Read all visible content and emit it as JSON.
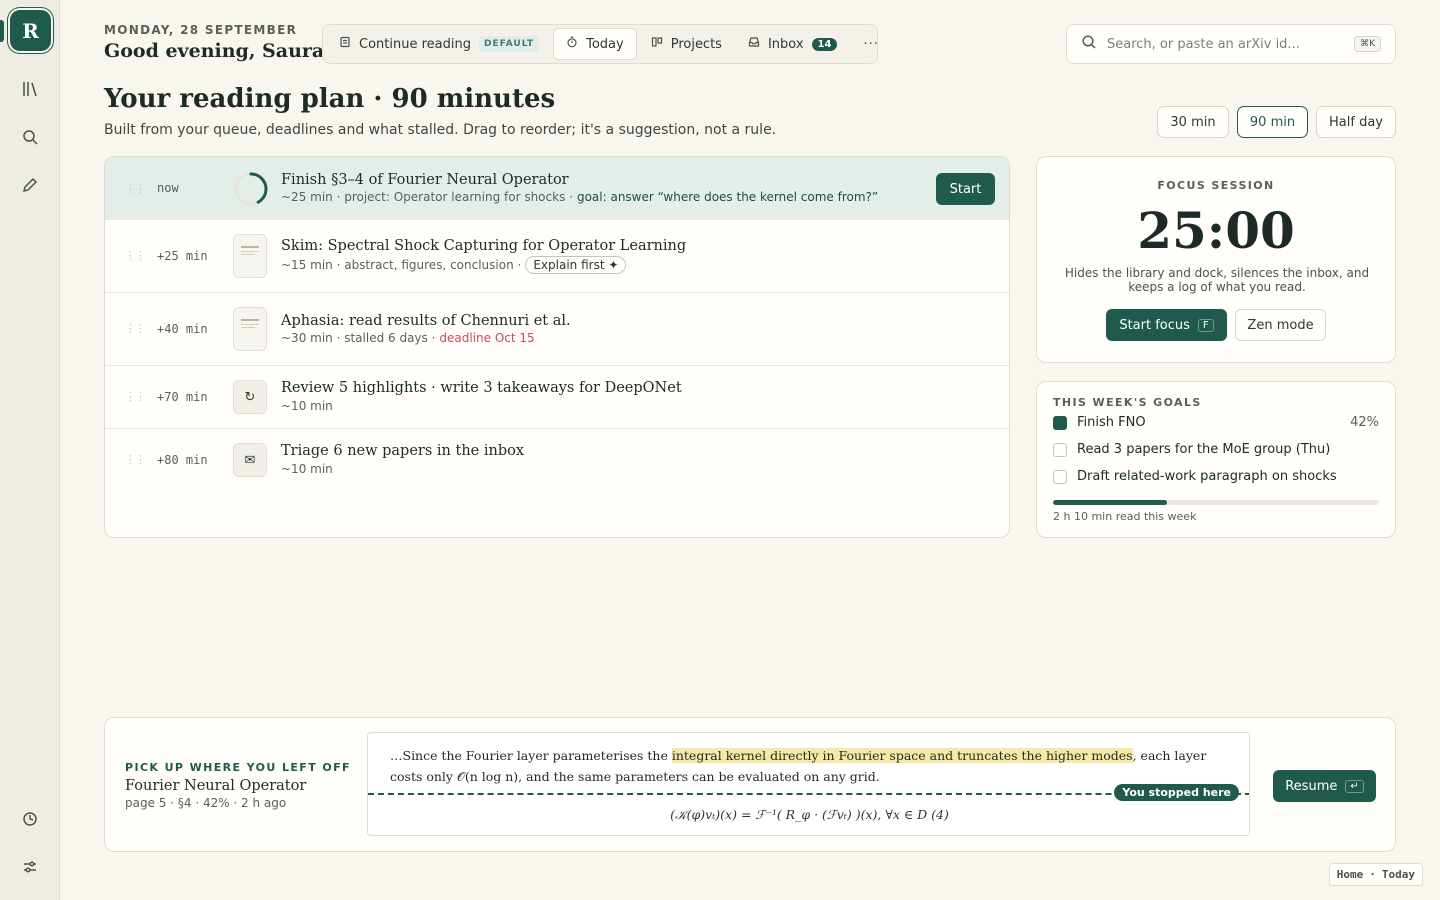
{
  "sidebar": {
    "logo": "R",
    "icons": [
      "library-icon",
      "search-icon",
      "pen-icon",
      "history-icon",
      "settings-sliders-icon"
    ]
  },
  "header": {
    "date": "MONDAY, 28 SEPTEMBER",
    "greeting": "Good evening, Saurav",
    "tabs": [
      {
        "label": "Continue reading",
        "tag": "DEFAULT",
        "icon": "document-icon"
      },
      {
        "label": "Today",
        "icon": "timer-icon",
        "active": true
      },
      {
        "label": "Projects",
        "icon": "kanban-icon"
      },
      {
        "label": "Inbox",
        "count": "14",
        "icon": "inbox-icon"
      }
    ],
    "more": "···",
    "search": {
      "placeholder": "Search, or paste an arXiv id...",
      "shortcut": "⌘K"
    }
  },
  "plan": {
    "title": "Your reading plan · 90 minutes",
    "subtitle": "Built from your queue, deadlines and what stalled. Drag to reorder; it's a suggestion, not a rule.",
    "durations": [
      {
        "label": "30 min"
      },
      {
        "label": "90 min",
        "active": true
      },
      {
        "label": "Half day"
      }
    ],
    "items": [
      {
        "offset": "now",
        "title": "Finish §3–4 of Fourier Neural Operator",
        "meta": "~25 min · project: Operator learning for shocks ·",
        "goal": "goal: answer “where does the kernel come from?”",
        "action": "Start",
        "progress": 0.42,
        "icon": "progress-ring-icon"
      },
      {
        "offset": "+25 min",
        "title": "Skim: Spectral Shock Capturing for Operator Learning",
        "meta": "~15 min · abstract, figures, conclusion ·",
        "chip": "Explain first ✦",
        "icon": "paper-thumbnail-icon"
      },
      {
        "offset": "+40 min",
        "title": "Aphasia: read results of Chennuri et al.",
        "meta": "~30 min · stalled 6 days ·",
        "deadline": "deadline Oct 15",
        "icon": "paper-thumbnail-icon"
      },
      {
        "offset": "+70 min",
        "title": "Review 5 highlights · write 3 takeaways for DeepONet",
        "meta": "~10 min",
        "glyph": "↻",
        "icon": "refresh-icon"
      },
      {
        "offset": "+80 min",
        "title": "Triage 6 new papers in the inbox",
        "meta": "~10 min",
        "glyph": "✉",
        "icon": "mail-icon"
      }
    ]
  },
  "focus": {
    "label": "FOCUS SESSION",
    "time": "25:00",
    "description": "Hides the library and dock, silences the inbox, and keeps a log of what you read.",
    "start_label": "Start focus",
    "start_key": "F",
    "zen_label": "Zen mode"
  },
  "goals": {
    "label": "THIS WEEK'S GOALS",
    "items": [
      {
        "label": "Finish FNO",
        "checked": true,
        "pct": "42%"
      },
      {
        "label": "Read 3 papers for the MoE group (Thu)",
        "checked": false
      },
      {
        "label": "Draft related-work paragraph on shocks",
        "checked": false
      }
    ],
    "progress": 0.35,
    "footer": "2 h 10 min read this week"
  },
  "resume": {
    "label": "PICK UP WHERE YOU LEFT OFF",
    "title": "Fourier Neural Operator",
    "meta": "page 5 · §4 · 42% · 2 h ago",
    "excerpt_before": "…Since the Fourier layer parameterises the ",
    "excerpt_highlight": "integral kernel directly in Fourier space and truncates the higher modes",
    "excerpt_after": ", each layer costs only 𝒪(n log n), and the same parameters can be evaluated on any grid.",
    "stop_label": "You stopped here",
    "formula": "(𝒦(φ)vₜ)(x) = ℱ⁻¹( R_φ · (ℱvₜ) )(x),  ∀x ∈ D   (4)",
    "button": "Resume",
    "button_key": "↵"
  },
  "breadcrumb": {
    "a": "Home",
    "sep": "·",
    "b": "Today"
  },
  "colors": {
    "accent": "#1f5a4c",
    "highlight": "#f6e9a6",
    "deadline": "#c0505f",
    "background": "#f8f6ef"
  }
}
